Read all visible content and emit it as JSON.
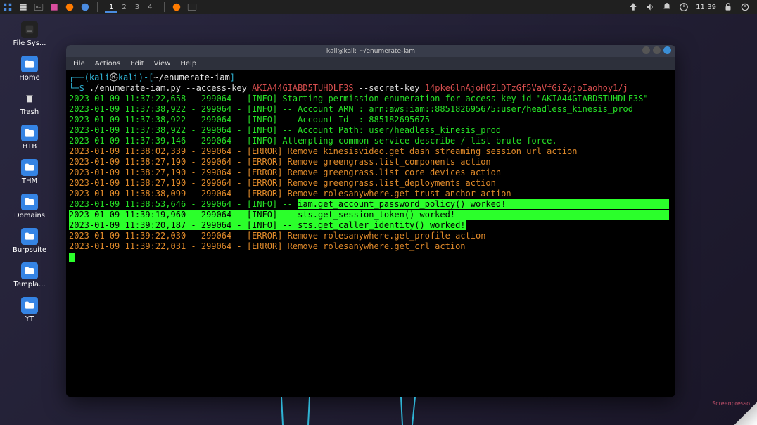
{
  "taskbar": {
    "workspaces": [
      "1",
      "2",
      "3",
      "4"
    ],
    "active_workspace": 0,
    "time": "11:39"
  },
  "desktop": {
    "icons": [
      {
        "label": "File Sys...",
        "type": "disk"
      },
      {
        "label": "Home",
        "type": "folder"
      },
      {
        "label": "Trash",
        "type": "trash"
      },
      {
        "label": "HTB",
        "type": "folder"
      },
      {
        "label": "THM",
        "type": "folder"
      },
      {
        "label": "Domains",
        "type": "folder"
      },
      {
        "label": "Burpsuite",
        "type": "folder"
      },
      {
        "label": "Templa...",
        "type": "folder"
      },
      {
        "label": "YT",
        "type": "folder"
      }
    ]
  },
  "window": {
    "title": "kali@kali: ~/enumerate-iam",
    "menu": [
      "File",
      "Actions",
      "Edit",
      "View",
      "Help"
    ]
  },
  "prompt": {
    "open": "┌──(",
    "user": "kali",
    "host": "kali",
    "sep_skull": "㉿",
    "close": ")-[",
    "path": "~/enumerate-iam",
    "end": "]",
    "line2": "└─",
    "dollar": "$"
  },
  "command": {
    "pre": " ./enumerate-iam.py --access-key ",
    "key": "AKIA44GIABD5TUHDLF3S",
    "mid": " --secret-key ",
    "secret": "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"
  },
  "lines": [
    {
      "t": "2023-01-09 11:37:22,658 - 299064 - [INFO] Starting permission enumeration for access-key-id \"AKIA44GIABD5TUHDLF3S\"",
      "c": "info"
    },
    {
      "t": "2023-01-09 11:37:38,922 - 299064 - [INFO] -- Account ARN : arn:aws:iam::885182695675:user/headless_kinesis_prod",
      "c": "info"
    },
    {
      "t": "2023-01-09 11:37:38,922 - 299064 - [INFO] -- Account Id  : 885182695675",
      "c": "info"
    },
    {
      "t": "2023-01-09 11:37:38,922 - 299064 - [INFO] -- Account Path: user/headless_kinesis_prod",
      "c": "info"
    },
    {
      "t": "2023-01-09 11:37:39,146 - 299064 - [INFO] Attempting common-service describe / list brute force.",
      "c": "info"
    },
    {
      "t": "2023-01-09 11:38:02,339 - 299064 - [ERROR] Remove kinesisvideo.get_dash_streaming_session_url action",
      "c": "err"
    },
    {
      "t": "2023-01-09 11:38:27,190 - 299064 - [ERROR] Remove greengrass.list_components action",
      "c": "err"
    },
    {
      "t": "2023-01-09 11:38:27,190 - 299064 - [ERROR] Remove greengrass.list_core_devices action",
      "c": "err"
    },
    {
      "t": "2023-01-09 11:38:27,190 - 299064 - [ERROR] Remove greengrass.list_deployments action",
      "c": "err"
    },
    {
      "t": "2023-01-09 11:38:38,099 - 299064 - [ERROR] Remove rolesanywhere.get_trust_anchor action",
      "c": "err"
    },
    {
      "pre": "2023-01-09 11:38:53,646 - 299064 - [INFO] -- ",
      "hl": "iam.get_account_password_policy() worked!",
      "fill": true,
      "c": "info"
    },
    {
      "hl": "2023-01-09 11:39:19,960 - 299064 - [INFO] -- sts.get_session_token() worked!",
      "fill": true,
      "c": "info"
    },
    {
      "hl": "2023-01-09 11:39:20,187 - 299064 - [INFO] -- sts.get_caller_identity() worked!",
      "c": "info"
    },
    {
      "t": "2023-01-09 11:39:22,030 - 299064 - [ERROR] Remove rolesanywhere.get_profile action",
      "c": "err"
    },
    {
      "t": "2023-01-09 11:39:22,031 - 299064 - [ERROR] Remove rolesanywhere.get_crl action",
      "c": "err"
    }
  ],
  "watermark": "Screenpresso"
}
